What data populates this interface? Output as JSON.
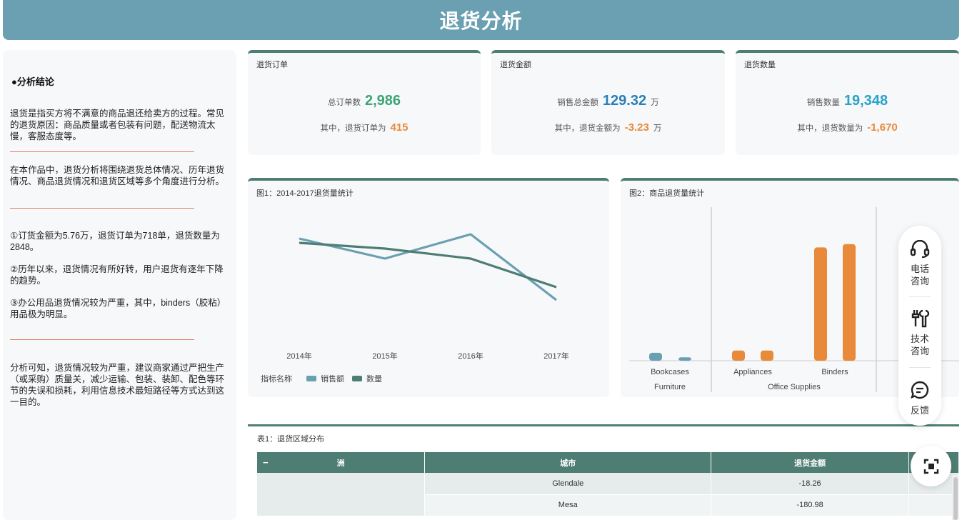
{
  "header": {
    "title": "退货分析"
  },
  "analysis": {
    "heading": "●分析结论",
    "intro": "退货是指买方将不满意的商品退还给卖方的过程。常见的退货原因：商品质量或者包装有问题，配送物流太慢，客服态度等。",
    "scope": "在本作品中，退货分析将围绕退货总体情况、历年退货情况、商品退货情况和退货区域等多个角度进行分析。",
    "finding1": "①订货金额为5.76万，退货订单为718单，退货数量为2848。",
    "finding2": "②历年以来，退货情况有所好转，用户退货有逐年下降的趋势。",
    "finding3": "③办公用品退货情况较为严重，其中，binders（胶粘）用品极为明显。",
    "conclusion": "分析可知，退货情况较为严重，建议商家通过严把生产（或采购）质量关，减少运输、包装、装卸、配色等环节的失误和损耗，利用信息技术最短路径等方式达到这一目的。"
  },
  "kpis": {
    "orders": {
      "title": "退货订单",
      "label": "总订单数",
      "value": "2,986",
      "sub_label": "其中，退货订单为",
      "sub_value": "415"
    },
    "amount": {
      "title": "退货金额",
      "label": "销售总金额",
      "value": "129.32",
      "unit": "万",
      "sub_label": "其中，退货金额为",
      "sub_value": "-3.23",
      "sub_unit": "万"
    },
    "quantity": {
      "title": "退货数量",
      "label": "销售数量",
      "value": "19,348",
      "sub_label": "其中，退货数量为",
      "sub_value": "-1,670"
    }
  },
  "chart_data": [
    {
      "type": "line",
      "title": "图1：2014-2017退货量统计",
      "categories": [
        "2014年",
        "2015年",
        "2016年",
        "2017年"
      ],
      "legend_title": "指标名称",
      "legend_position": "bottom-left",
      "grid": false,
      "series": [
        {
          "name": "销售额",
          "color": "#6aa0b2",
          "values": [
            0.82,
            0.68,
            0.85,
            0.39
          ]
        },
        {
          "name": "数量",
          "color": "#4e7d74",
          "values": [
            0.79,
            0.75,
            0.68,
            0.48
          ]
        }
      ],
      "ylim": [
        0,
        1
      ]
    },
    {
      "type": "bar",
      "title": "图2：商品退货量统计",
      "grid": false,
      "groups": [
        {
          "label": "Furniture",
          "categories": [
            "Bookcases",
            ""
          ],
          "values": [
            7,
            3
          ],
          "color": "#6aa0b2"
        },
        {
          "label": "Office Supplies",
          "categories": [
            "Appliances",
            "Binders"
          ],
          "values": [
            9,
            9,
            100,
            103
          ],
          "color": "#e88a3a"
        }
      ],
      "bars": [
        {
          "category": "Bookcases",
          "value": 7,
          "color": "#6aa0b2"
        },
        {
          "category": "Bookcases",
          "value": 3,
          "color": "#6aa0b2"
        },
        {
          "category": "Appliances",
          "value": 9,
          "color": "#e88a3a"
        },
        {
          "category": "Appliances",
          "value": 9,
          "color": "#e88a3a"
        },
        {
          "category": "Binders",
          "value": 100,
          "color": "#e88a3a"
        },
        {
          "category": "Binders",
          "value": 103,
          "color": "#e88a3a"
        }
      ],
      "ylim": [
        0,
        140
      ]
    }
  ],
  "table": {
    "title": "表1：退货区域分布",
    "collapse_symbol": "−",
    "columns": [
      "洲",
      "城市",
      "退货金额"
    ],
    "rows": [
      {
        "city": "Glendale",
        "amount": "-18.26"
      },
      {
        "city": "Mesa",
        "amount": "-180.98"
      }
    ]
  },
  "float_menu": {
    "phone": "电话咨询",
    "tech": "技术咨询",
    "feedback": "反馈"
  },
  "colors": {
    "header": "#6aa0b2",
    "accent": "#4e7d74",
    "orange": "#e88a3a",
    "green": "#3fa374",
    "blue": "#2a7fb6"
  }
}
